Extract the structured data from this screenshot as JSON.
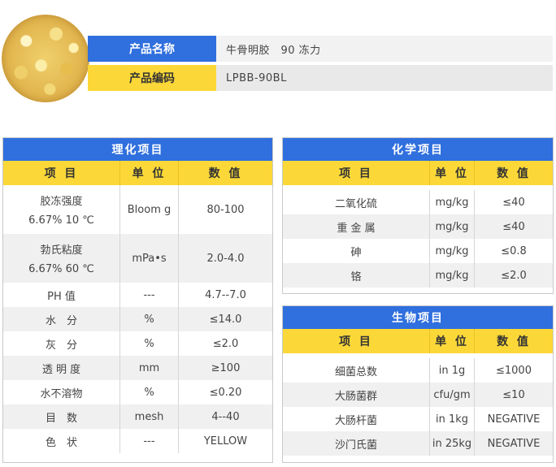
{
  "header": {
    "name_label": "产品名称",
    "name_value": "牛骨明胶　90 冻力",
    "code_label": "产品编码",
    "code_value": "LPBB-90BL"
  },
  "columns": {
    "item": "项 目",
    "unit": "单 位",
    "value": "数 值"
  },
  "physical": {
    "title": "理化项目",
    "rows": [
      {
        "item": "胶冻强度",
        "item_sub": "6.67% 10 ℃",
        "unit": "Bloom g",
        "value": "80-100"
      },
      {
        "item": "勃氏粘度",
        "item_sub": "6.67% 60 ℃",
        "unit": "mPa•s",
        "value": "2.0-4.0"
      },
      {
        "item": "PH 值",
        "unit": "---",
        "value": "4.7--7.0"
      },
      {
        "item": "水　分",
        "unit": "%",
        "value": "≤14.0"
      },
      {
        "item": "灰　分",
        "unit": "%",
        "value": "≤2.0"
      },
      {
        "item": "透 明 度",
        "unit": "mm",
        "value": "≥100"
      },
      {
        "item": "水不溶物",
        "unit": "%",
        "value": "≤0.20"
      },
      {
        "item": "目　数",
        "unit": "mesh",
        "value": "4--40"
      },
      {
        "item": "色　状",
        "unit": "---",
        "value": "YELLOW"
      }
    ]
  },
  "chemical": {
    "title": "化学项目",
    "rows": [
      {
        "item": "二氧化硫",
        "unit": "mg/kg",
        "value": "≤40"
      },
      {
        "item": "重 金 属",
        "unit": "mg/kg",
        "value": "≤40"
      },
      {
        "item": "砷",
        "unit": "mg/kg",
        "value": "≤0.8"
      },
      {
        "item": "铬",
        "unit": "mg/kg",
        "value": "≤2.0"
      }
    ]
  },
  "biological": {
    "title": "生物项目",
    "rows": [
      {
        "item": "细菌总数",
        "unit": "in 1g",
        "value": "≤1000"
      },
      {
        "item": "大肠菌群",
        "unit": "cfu/gm",
        "value": "≤10"
      },
      {
        "item": "大肠杆菌",
        "unit": "in 1kg",
        "value": "NEGATIVE"
      },
      {
        "item": "沙门氏菌",
        "unit": "in 25kg",
        "value": "NEGATIVE"
      }
    ]
  }
}
